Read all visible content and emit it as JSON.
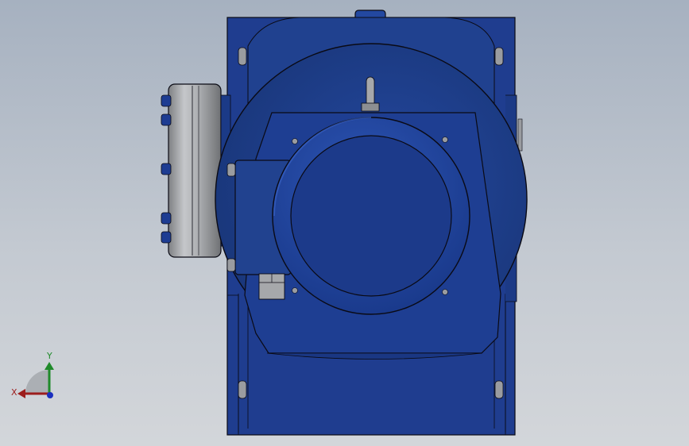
{
  "viewport": {
    "background_top": "#a6b1c0",
    "background_bottom": "#d3d6da"
  },
  "model": {
    "body_color": "#1f3d8f",
    "body_dark": "#142a6b",
    "body_light": "#2f55b0",
    "steel_color": "#a9abae",
    "outline_color": "#0a0a14"
  },
  "triad": {
    "x_label": "X",
    "y_label": "Y",
    "x_color": "#9c1d1d",
    "y_color": "#1f8a2a",
    "z_color": "#1a2fbf"
  }
}
